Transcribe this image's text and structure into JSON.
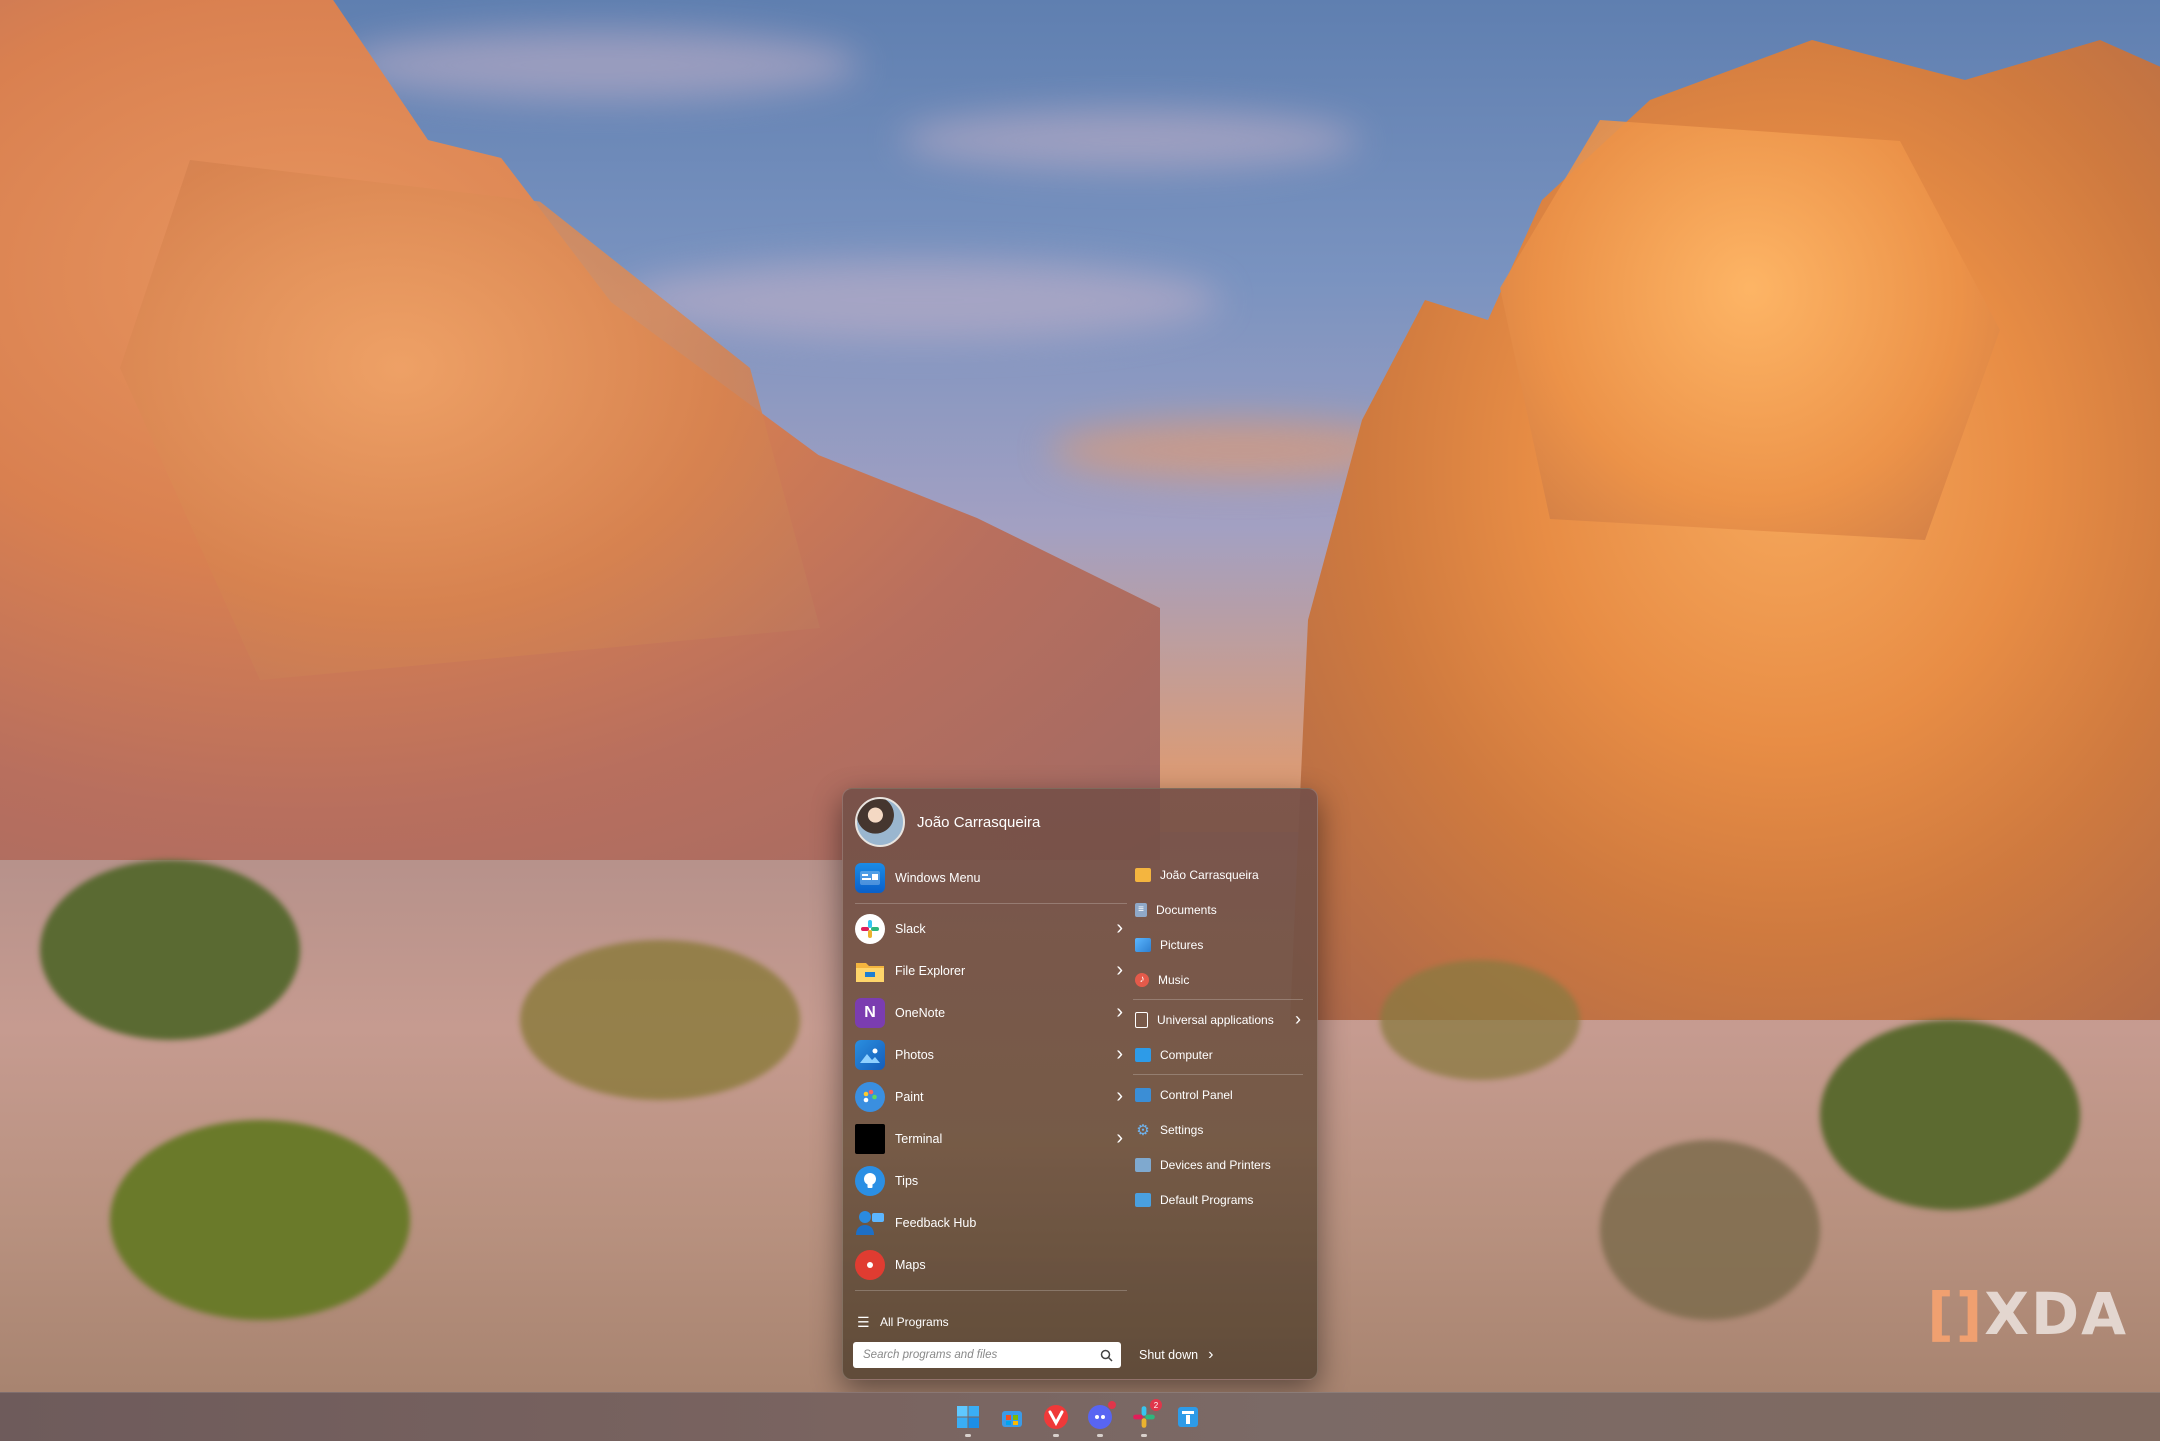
{
  "user": {
    "name": "João Carrasqueira"
  },
  "pinned": {
    "header_item": {
      "label": "Windows Menu",
      "icon": "windows-menu-icon"
    },
    "items": [
      {
        "label": "Slack",
        "icon": "slack-icon",
        "has_submenu": true
      },
      {
        "label": "File Explorer",
        "icon": "folder-icon",
        "has_submenu": true
      },
      {
        "label": "OneNote",
        "icon": "onenote-icon",
        "has_submenu": true
      },
      {
        "label": "Photos",
        "icon": "photos-icon",
        "has_submenu": true
      },
      {
        "label": "Paint",
        "icon": "paint-icon",
        "has_submenu": true
      },
      {
        "label": "Terminal",
        "icon": "terminal-icon",
        "has_submenu": true
      },
      {
        "label": "Tips",
        "icon": "lightbulb-icon",
        "has_submenu": false
      },
      {
        "label": "Feedback Hub",
        "icon": "feedback-hub-icon",
        "has_submenu": false
      },
      {
        "label": "Maps",
        "icon": "maps-pin-icon",
        "has_submenu": false
      }
    ],
    "all_programs": "All Programs"
  },
  "places": {
    "group1": [
      {
        "label": "João Carrasqueira",
        "icon": "folder-icon"
      },
      {
        "label": "Documents",
        "icon": "documents-icon"
      },
      {
        "label": "Pictures",
        "icon": "pictures-icon"
      },
      {
        "label": "Music",
        "icon": "music-icon"
      }
    ],
    "group2": [
      {
        "label": "Universal applications",
        "icon": "file-icon",
        "has_submenu": true
      },
      {
        "label": "Computer",
        "icon": "computer-icon",
        "has_submenu": false
      }
    ],
    "group3": [
      {
        "label": "Control Panel",
        "icon": "control-panel-icon"
      },
      {
        "label": "Settings",
        "icon": "gear-icon"
      },
      {
        "label": "Devices and Printers",
        "icon": "printer-icon"
      },
      {
        "label": "Default Programs",
        "icon": "default-programs-icon"
      }
    ]
  },
  "search": {
    "placeholder": "Search programs and files",
    "value": ""
  },
  "shutdown": {
    "label": "Shut down"
  },
  "taskbar": {
    "icons": [
      {
        "name": "start-icon"
      },
      {
        "name": "store-icon"
      },
      {
        "name": "vivaldi-icon"
      },
      {
        "name": "discord-icon",
        "badge": ""
      },
      {
        "name": "slack-icon",
        "badge": "2"
      },
      {
        "name": "app-icon"
      }
    ]
  },
  "watermark": {
    "mark": "[]",
    "text": "XDA"
  },
  "colors": {
    "accent": "#0a78d4",
    "menu_bg": "#76504A",
    "onenote": "#7b3db0",
    "maps_red": "#e03c31"
  }
}
